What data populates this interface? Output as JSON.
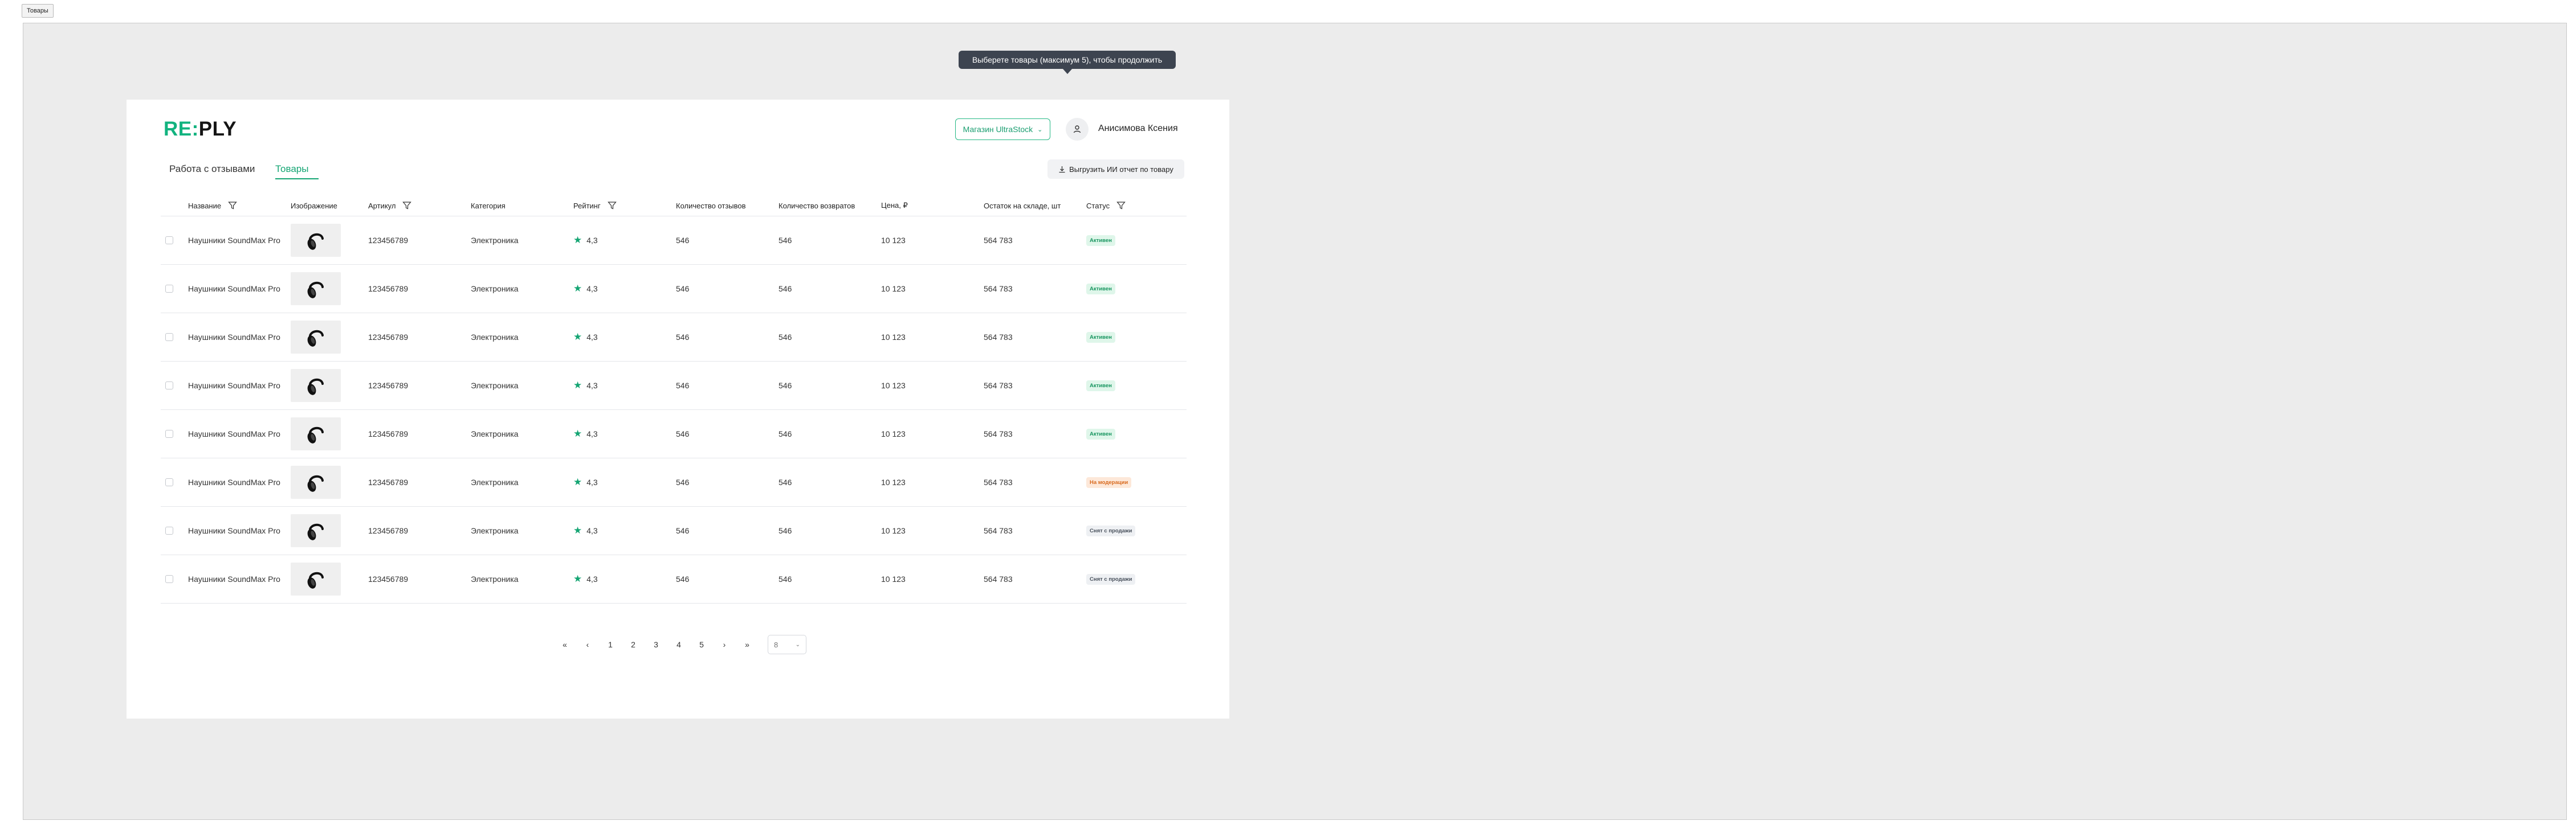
{
  "top_tab": {
    "label": "Товары"
  },
  "tooltip": {
    "text": "Выберете товары (максимум 5), чтобы продолжить"
  },
  "header": {
    "logo_green": "RE:",
    "logo_black": "PLY",
    "store_select": "Магазин UltraStock",
    "user_name": "Анисимова Ксения"
  },
  "nav": {
    "tabs": [
      {
        "label": "Работа с отзывами"
      },
      {
        "label": "Товары"
      }
    ],
    "active_tab": "Товары",
    "export_button": "Выгрузить ИИ отчет по товару"
  },
  "table": {
    "columns": [
      {
        "label": "Название"
      },
      {
        "label": "Изображение"
      },
      {
        "label": "Артикул"
      },
      {
        "label": "Категория"
      },
      {
        "label": "Рейтинг"
      },
      {
        "label": "Количество отзывов"
      },
      {
        "label": "Количество возвратов"
      },
      {
        "label": "Цена, ₽"
      },
      {
        "label": "Остаток на складе, шт"
      },
      {
        "label": "Статус"
      }
    ],
    "rows": [
      {
        "name": "Наушники SoundMax Pro",
        "sku": "123456789",
        "category": "Электроника",
        "rating": "4,3",
        "reviews": "546",
        "returns": "546",
        "price": "10 123",
        "stock": "564 783",
        "status": "Активен",
        "status_color": "green"
      },
      {
        "name": "Наушники SoundMax Pro",
        "sku": "123456789",
        "category": "Электроника",
        "rating": "4,3",
        "reviews": "546",
        "returns": "546",
        "price": "10 123",
        "stock": "564 783",
        "status": "Активен",
        "status_color": "green"
      },
      {
        "name": "Наушники SoundMax Pro",
        "sku": "123456789",
        "category": "Электроника",
        "rating": "4,3",
        "reviews": "546",
        "returns": "546",
        "price": "10 123",
        "stock": "564 783",
        "status": "Активен",
        "status_color": "green"
      },
      {
        "name": "Наушники SoundMax Pro",
        "sku": "123456789",
        "category": "Электроника",
        "rating": "4,3",
        "reviews": "546",
        "returns": "546",
        "price": "10 123",
        "stock": "564 783",
        "status": "Активен",
        "status_color": "green"
      },
      {
        "name": "Наушники SoundMax Pro",
        "sku": "123456789",
        "category": "Электроника",
        "rating": "4,3",
        "reviews": "546",
        "returns": "546",
        "price": "10 123",
        "stock": "564 783",
        "status": "Активен",
        "status_color": "green"
      },
      {
        "name": "Наушники SoundMax Pro",
        "sku": "123456789",
        "category": "Электроника",
        "rating": "4,3",
        "reviews": "546",
        "returns": "546",
        "price": "10 123",
        "stock": "564 783",
        "status": "На модерации",
        "status_color": "orange"
      },
      {
        "name": "Наушники SoundMax Pro",
        "sku": "123456789",
        "category": "Электроника",
        "rating": "4,3",
        "reviews": "546",
        "returns": "546",
        "price": "10 123",
        "stock": "564 783",
        "status": "Снят с продажи",
        "status_color": "gray"
      },
      {
        "name": "Наушники SoundMax Pro",
        "sku": "123456789",
        "category": "Электроника",
        "rating": "4,3",
        "reviews": "546",
        "returns": "546",
        "price": "10 123",
        "stock": "564 783",
        "status": "Снят с продажи",
        "status_color": "gray"
      }
    ]
  },
  "pagination": {
    "first": "«",
    "prev": "‹",
    "pages": [
      "1",
      "2",
      "3",
      "4",
      "5"
    ],
    "next": "›",
    "last": "»",
    "page_size": "8"
  },
  "colors": {
    "accent": "#14a573",
    "tooltip_bg": "#3d4450",
    "canvas_bg": "#ececec"
  },
  "icons": {
    "filter": "filter-icon",
    "user": "user-icon",
    "download": "download-icon",
    "star": "star-icon",
    "product": "headphones-icon"
  }
}
